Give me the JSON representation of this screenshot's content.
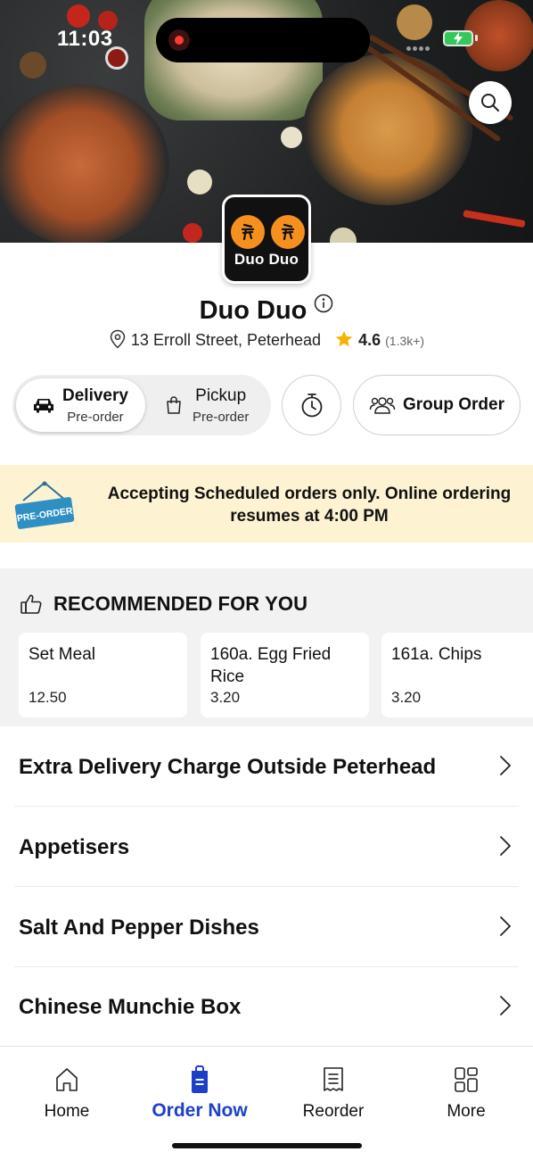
{
  "status_bar": {
    "time": "11:03"
  },
  "store": {
    "name": "Duo Duo",
    "logo_text": "Duo Duo",
    "address": "13 Erroll Street, Peterhead",
    "rating": "4.6",
    "rating_count": "(1.3k+)"
  },
  "modes": {
    "delivery": {
      "label": "Delivery",
      "sub": "Pre-order"
    },
    "pickup": {
      "label": "Pickup",
      "sub": "Pre-order"
    },
    "group_order": "Group Order"
  },
  "banner": {
    "sign_text": "PRE-ORDER",
    "message": "Accepting Scheduled orders only. Online ordering resumes at 4:00 PM"
  },
  "recommended": {
    "title": "RECOMMENDED FOR YOU",
    "items": [
      {
        "name": "Set Meal",
        "price": "12.50"
      },
      {
        "name": "160a. Egg Fried Rice",
        "price": "3.20"
      },
      {
        "name": "161a. Chips",
        "price": "3.20"
      }
    ]
  },
  "categories": [
    "Extra Delivery Charge Outside Peterhead",
    "Appetisers",
    "Salt And Pepper Dishes",
    "Chinese Munchie Box"
  ],
  "tabs": [
    {
      "label": "Home",
      "icon": "home-icon"
    },
    {
      "label": "Order Now",
      "icon": "order-bag-icon"
    },
    {
      "label": "Reorder",
      "icon": "receipt-icon"
    },
    {
      "label": "More",
      "icon": "grid-icon"
    }
  ],
  "colors": {
    "accent": "#1d40c8",
    "banner_bg": "#fdf3d3",
    "star": "#f5b301",
    "logo_orange": "#f5901e"
  }
}
